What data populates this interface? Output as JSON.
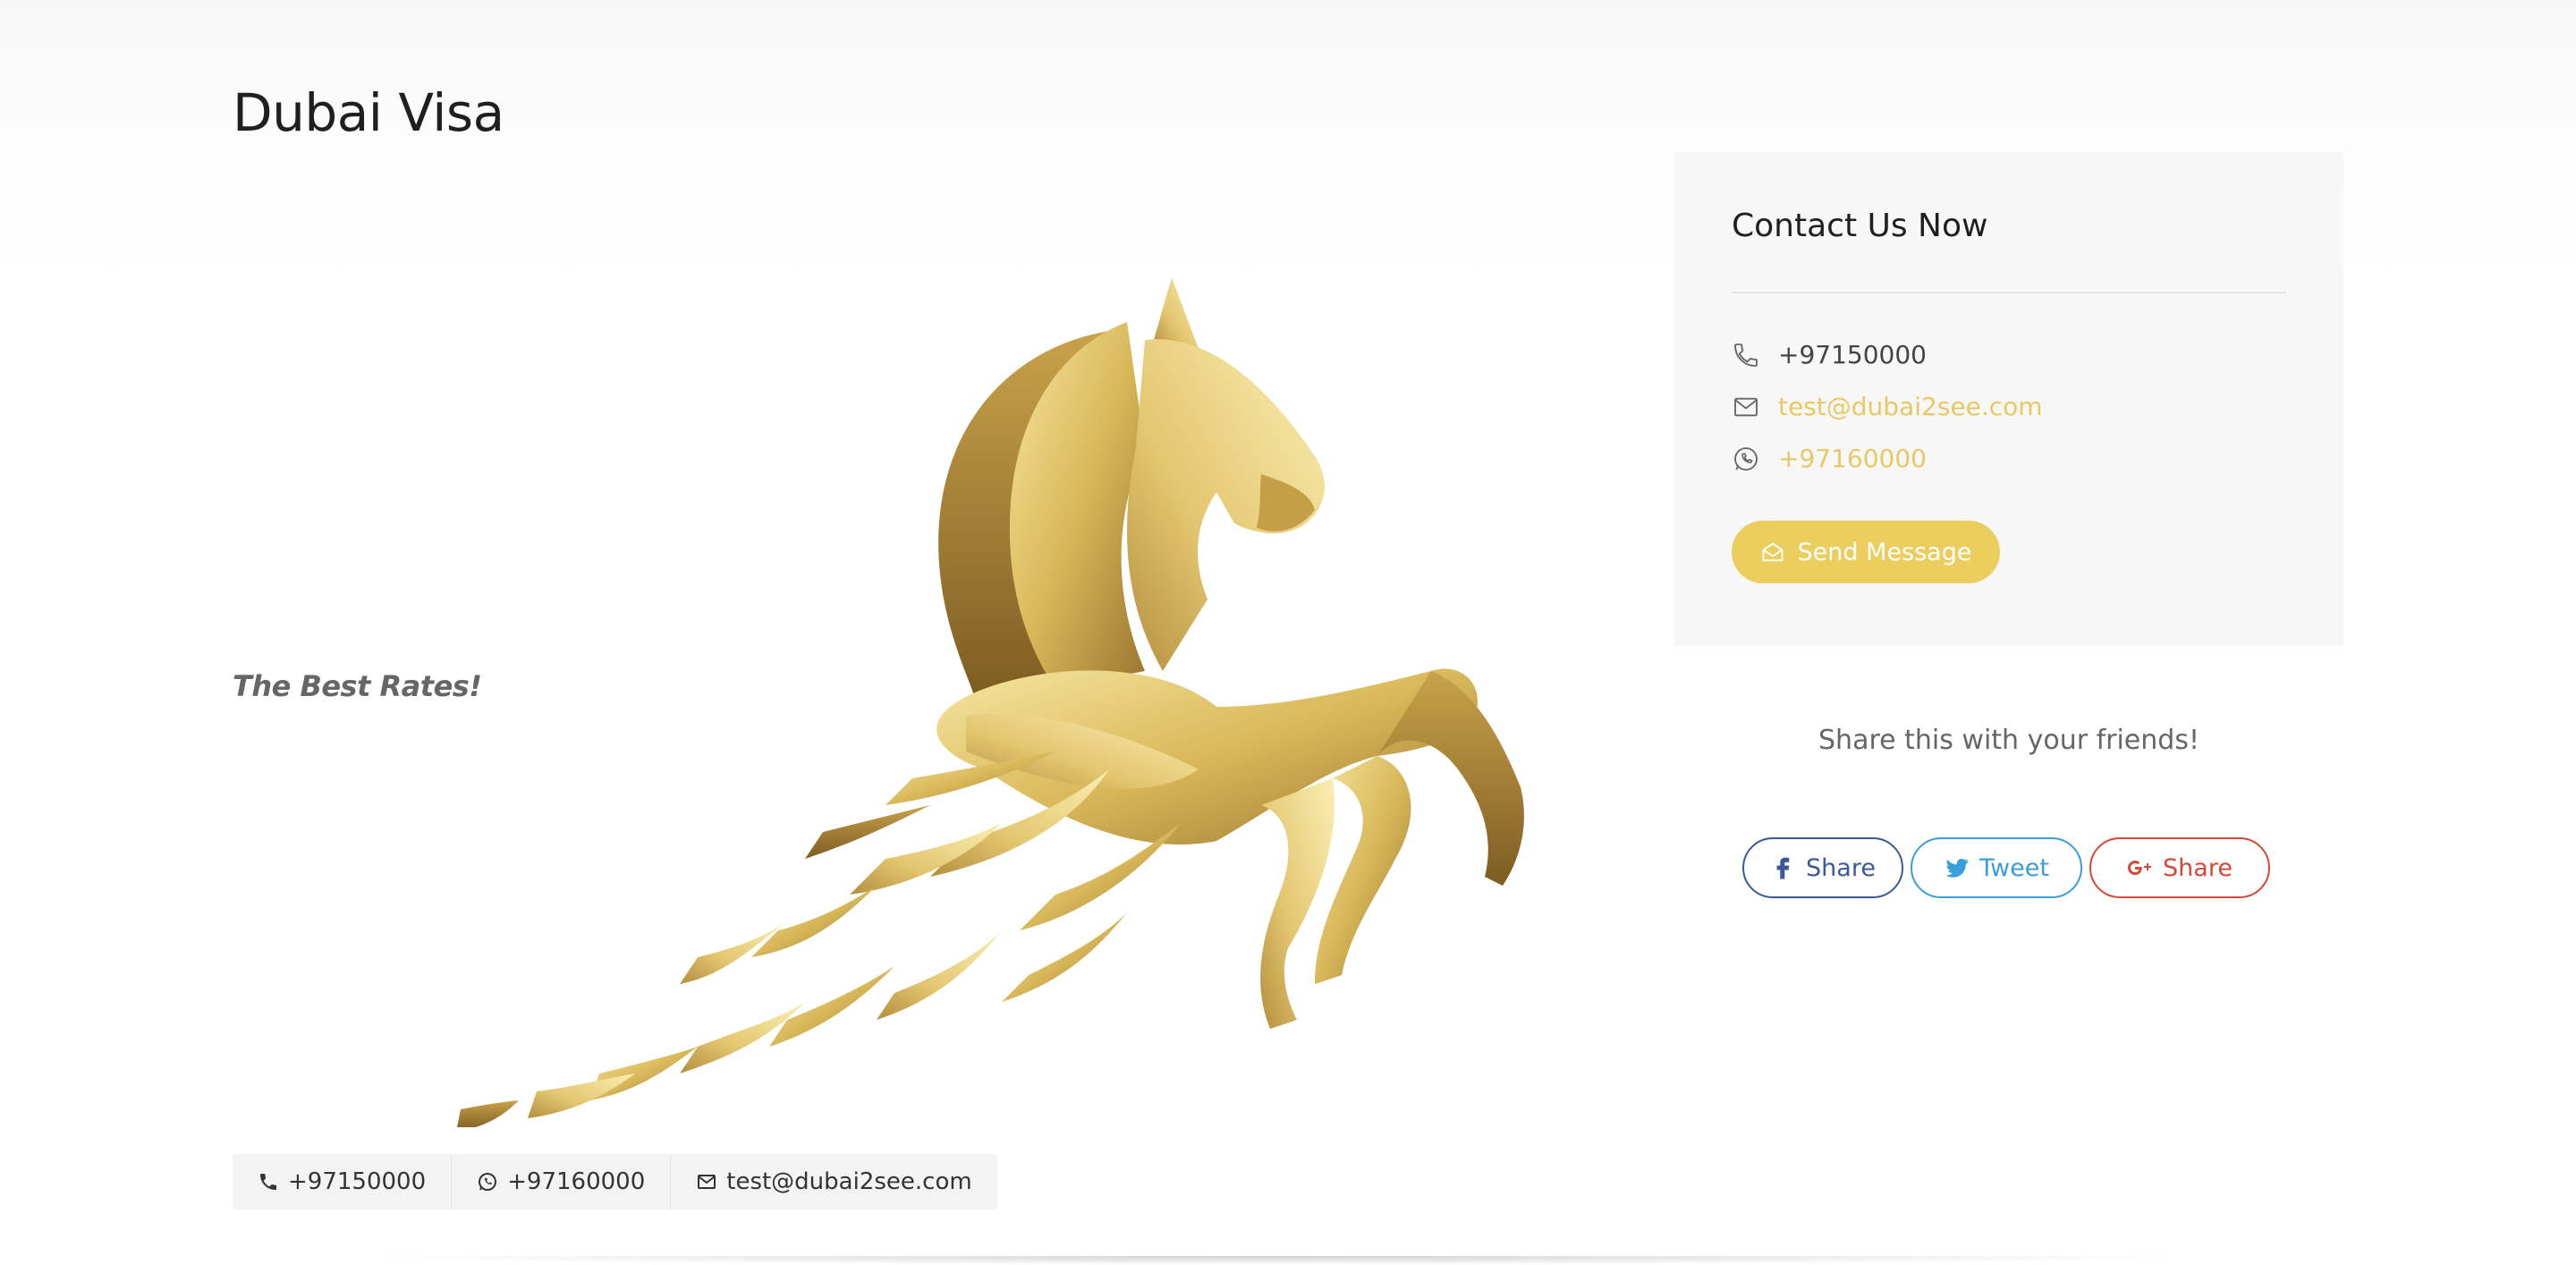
{
  "page": {
    "title": "Dubai Visa",
    "tagline": "The Best Rates!"
  },
  "contact_bar": {
    "phone": "+97150000",
    "whatsapp": "+97160000",
    "email": "test@dubai2see.com"
  },
  "contact_card": {
    "title": "Contact Us Now",
    "phone": "+97150000",
    "email": "test@dubai2see.com",
    "whatsapp": "+97160000",
    "send_label": "Send Message"
  },
  "share": {
    "heading": "Share this with your friends!",
    "facebook_label": "Share",
    "twitter_label": "Tweet",
    "google_label": "Share"
  },
  "colors": {
    "accent": "#ecce5e",
    "link": "#e9c864",
    "facebook": "#3b5998",
    "twitter": "#3a9ddc",
    "google": "#d34836"
  },
  "icons": {
    "phone": "phone-icon",
    "email": "envelope-icon",
    "whatsapp": "whatsapp-icon",
    "send": "envelope-open-icon",
    "facebook": "facebook-icon",
    "twitter": "twitter-icon",
    "google": "google-plus-icon"
  }
}
